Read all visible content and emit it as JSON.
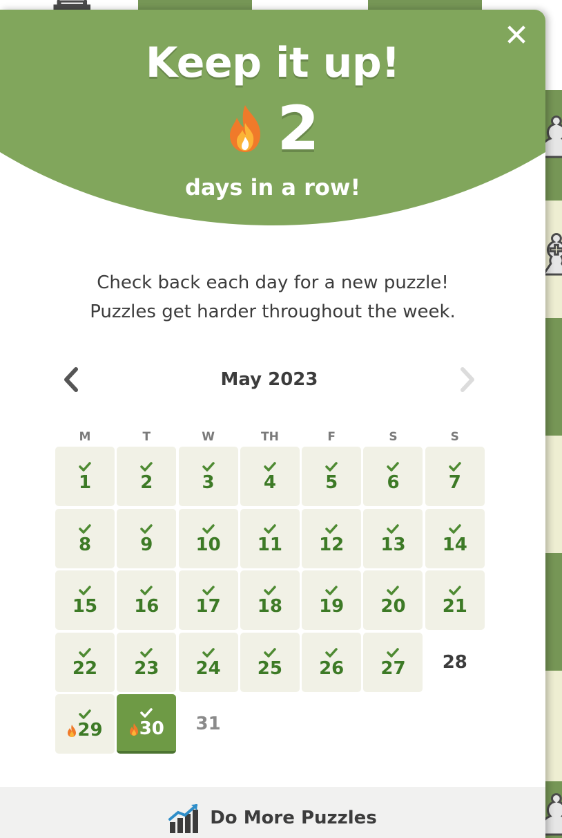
{
  "modal": {
    "close_label": "✕",
    "headline": "Keep it up!",
    "streak_count": "2",
    "streak_caption": "days in a row!",
    "info_line1": "Check back each day for a new puzzle!",
    "info_line2": "Puzzles get harder throughout the week."
  },
  "calendar": {
    "month_label": "May 2023",
    "weekday_labels": [
      "M",
      "T",
      "W",
      "TH",
      "F",
      "S",
      "S"
    ],
    "days": [
      {
        "num": "1",
        "status": "solved"
      },
      {
        "num": "2",
        "status": "solved"
      },
      {
        "num": "3",
        "status": "solved"
      },
      {
        "num": "4",
        "status": "solved"
      },
      {
        "num": "5",
        "status": "solved"
      },
      {
        "num": "6",
        "status": "solved"
      },
      {
        "num": "7",
        "status": "solved"
      },
      {
        "num": "8",
        "status": "solved"
      },
      {
        "num": "9",
        "status": "solved"
      },
      {
        "num": "10",
        "status": "solved"
      },
      {
        "num": "11",
        "status": "solved"
      },
      {
        "num": "12",
        "status": "solved"
      },
      {
        "num": "13",
        "status": "solved"
      },
      {
        "num": "14",
        "status": "solved"
      },
      {
        "num": "15",
        "status": "solved"
      },
      {
        "num": "16",
        "status": "solved"
      },
      {
        "num": "17",
        "status": "solved"
      },
      {
        "num": "18",
        "status": "solved"
      },
      {
        "num": "19",
        "status": "solved"
      },
      {
        "num": "20",
        "status": "solved"
      },
      {
        "num": "21",
        "status": "solved"
      },
      {
        "num": "22",
        "status": "solved"
      },
      {
        "num": "23",
        "status": "solved"
      },
      {
        "num": "24",
        "status": "solved"
      },
      {
        "num": "25",
        "status": "solved"
      },
      {
        "num": "26",
        "status": "solved"
      },
      {
        "num": "27",
        "status": "solved"
      },
      {
        "num": "28",
        "status": "unsolved"
      },
      {
        "num": "29",
        "status": "streak"
      },
      {
        "num": "30",
        "status": "today"
      },
      {
        "num": "31",
        "status": "future"
      }
    ]
  },
  "footer": {
    "label": "Do More Puzzles",
    "icon": "puzzles-chart-icon"
  },
  "colors": {
    "header_green": "#81a65c",
    "solved_text": "#3d7a26",
    "solved_bg": "#f1f1e6",
    "today_bg": "#6e9a45"
  }
}
